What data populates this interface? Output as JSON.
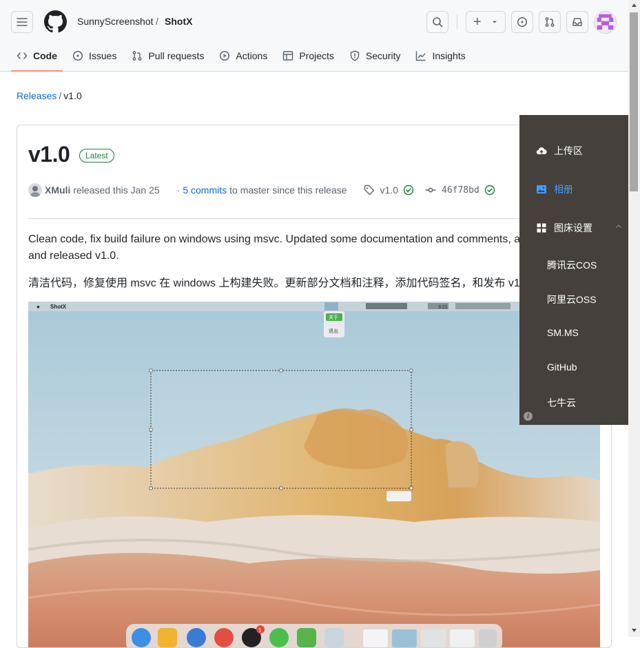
{
  "header": {
    "owner": "SunnyScreenshot",
    "separator": "/",
    "repo": "ShotX",
    "create_plus": "+"
  },
  "tabs": [
    {
      "label": "Code",
      "icon": "code-icon",
      "active": true
    },
    {
      "label": "Issues",
      "icon": "issue-opened-icon"
    },
    {
      "label": "Pull requests",
      "icon": "git-pull-request-icon"
    },
    {
      "label": "Actions",
      "icon": "play-icon"
    },
    {
      "label": "Projects",
      "icon": "table-icon"
    },
    {
      "label": "Security",
      "icon": "shield-icon"
    },
    {
      "label": "Insights",
      "icon": "graph-icon"
    }
  ],
  "breadcrumb": {
    "releases": "Releases",
    "sep": "/",
    "current": "v1.0"
  },
  "release": {
    "title": "v1.0",
    "badge": "Latest",
    "author": "XMuli",
    "released_text": "released this Jan 25",
    "dot": "·",
    "commits_link": "5 commits",
    "commits_suffix": "to master since this release",
    "tag": "v1.0",
    "commit_sha": "46f78bd",
    "body_en_1": "Clean code, fix build failure on windows using msvc. Updated some documentation and comments, ad",
    "body_en_2": "and released v1.0.",
    "body_zh": "清洁代码，修复使用 msvc 在 windows 上构建失败。更新部分文档和注释，添加代码签名，和发布 v1.",
    "verified_color": "#1a7f37"
  },
  "screenshot": {
    "menubar_app": "ShotX",
    "menubar_time": "3:21",
    "menu_about": "关于",
    "menu_exit": "退出",
    "qq_badge": "1"
  },
  "popup": {
    "upload": "上传区",
    "album": "相册",
    "settings": "图床设置",
    "providers": [
      "腾讯云COS",
      "阿里云OSS",
      "SM.MS",
      "GitHub",
      "七牛云"
    ],
    "active_color": "#409eff",
    "info": "i"
  }
}
